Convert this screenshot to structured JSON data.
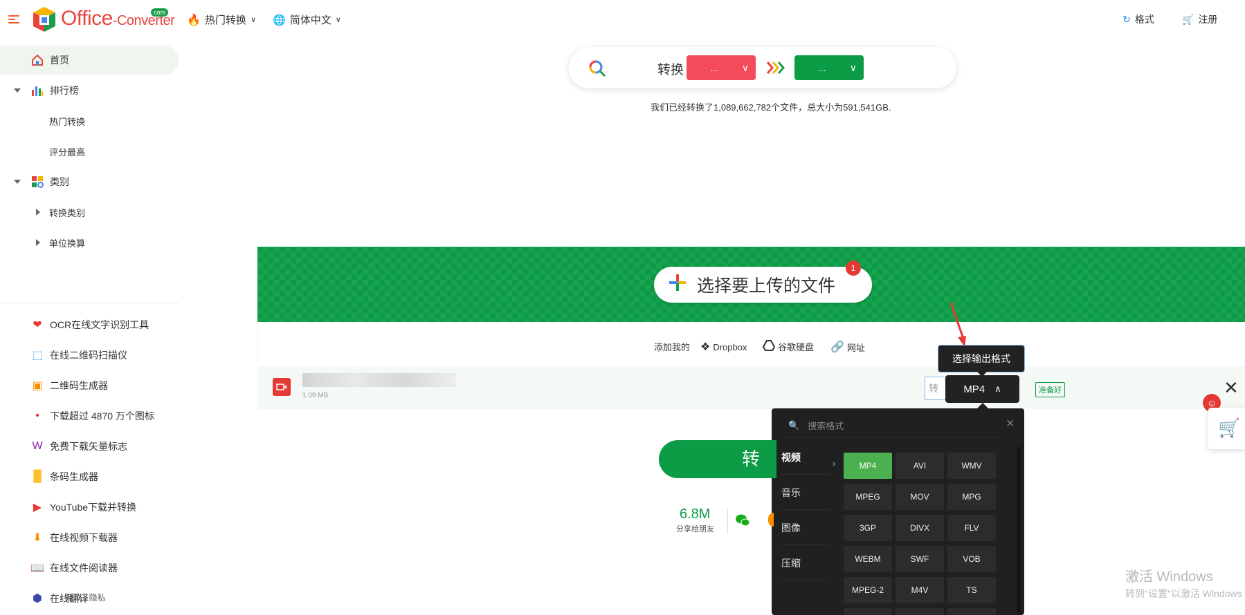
{
  "header": {
    "logo_text": "Office",
    "logo_sub": "-Converter",
    "logo_com": "com",
    "hot_label": "热门转换",
    "lang_label": "简体中文",
    "formats_label": "格式",
    "register_label": "注册"
  },
  "sidebar": {
    "home": "首页",
    "ranking": "排行榜",
    "hot": "热门转换",
    "top_rated": "评分最高",
    "category": "类别",
    "conv_cat": "转换类别",
    "unit_conv": "单位换算",
    "tools": [
      {
        "label": "OCR在线文字识别工具",
        "icon": "heart-icon",
        "color": "#e53935"
      },
      {
        "label": "在线二维码扫描仪",
        "icon": "qr-scan-icon",
        "color": "#1e88e5"
      },
      {
        "label": "二维码生成器",
        "icon": "qr-generator-icon",
        "color": "#fb8c00"
      },
      {
        "label": "下载超过 4870 万个图标",
        "icon": "icons-icon",
        "color": "#e53935"
      },
      {
        "label": "免费下载矢量标志",
        "icon": "vector-logo-icon",
        "color": "#8e24aa"
      },
      {
        "label": "条码生成器",
        "icon": "barcode-icon",
        "color": "#fbc02d"
      },
      {
        "label": "YouTube下载并转换",
        "icon": "youtube-icon",
        "color": "#e53935"
      },
      {
        "label": "在线视频下载器",
        "icon": "video-download-icon",
        "color": "#fb8c00"
      },
      {
        "label": "在线文件阅读器",
        "icon": "file-reader-icon",
        "color": "#039be5"
      },
      {
        "label": "在线翻译",
        "icon": "translate-icon",
        "color": "#3949ab"
      }
    ],
    "footer": "条款 · 隐私"
  },
  "converter": {
    "label": "转换",
    "from_value": "...",
    "to_value": "...",
    "stats_text": "我们已经转换了1,089,662,782个文件，总大小为591,541GB."
  },
  "upload": {
    "button_label": "选择要上传的文件",
    "badge_count": "1",
    "add_from": "添加我的",
    "dropbox": "Dropbox",
    "gdrive": "谷歌硬盘",
    "url": "网址",
    "file_size": "1.09 MB",
    "convert_to_partial": "转",
    "selected_format": "MP4",
    "status": "准备好",
    "tooltip": "选择输出格式"
  },
  "format_panel": {
    "search_placeholder": "搜索格式",
    "categories": [
      "视频",
      "音乐",
      "图像",
      "压缩"
    ],
    "formats": [
      "MP4",
      "AVI",
      "WMV",
      "MPEG",
      "MOV",
      "MPG",
      "3GP",
      "DIVX",
      "FLV",
      "WEBM",
      "SWF",
      "VOB",
      "MPEG-2",
      "M4V",
      "TS"
    ]
  },
  "bottom": {
    "convert_label": "转换",
    "share_count": "6.8M",
    "share_label": "分享给朋友"
  },
  "watermark": {
    "line1": "激活 Windows",
    "line2": "转到\"设置\"以激活 Windows"
  },
  "colors": {
    "brand_green": "#0b9c45",
    "from_red": "#f44b5a",
    "to_green": "#0b9c45",
    "panel_dark": "#202020",
    "active_format": "#4caf50"
  }
}
